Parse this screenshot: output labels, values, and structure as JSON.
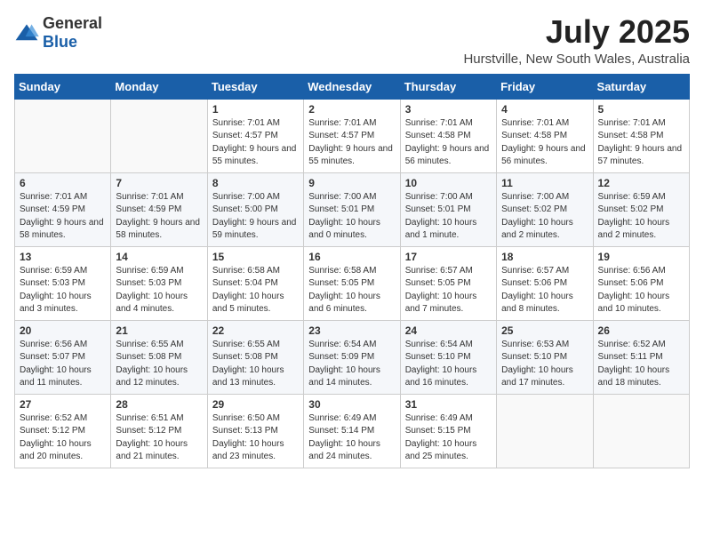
{
  "header": {
    "logo": {
      "general": "General",
      "blue": "Blue"
    },
    "title": "July 2025",
    "location": "Hurstville, New South Wales, Australia"
  },
  "calendar": {
    "days_of_week": [
      "Sunday",
      "Monday",
      "Tuesday",
      "Wednesday",
      "Thursday",
      "Friday",
      "Saturday"
    ],
    "weeks": [
      [
        {
          "day": "",
          "info": ""
        },
        {
          "day": "",
          "info": ""
        },
        {
          "day": "1",
          "info": "Sunrise: 7:01 AM\nSunset: 4:57 PM\nDaylight: 9 hours and 55 minutes."
        },
        {
          "day": "2",
          "info": "Sunrise: 7:01 AM\nSunset: 4:57 PM\nDaylight: 9 hours and 55 minutes."
        },
        {
          "day": "3",
          "info": "Sunrise: 7:01 AM\nSunset: 4:58 PM\nDaylight: 9 hours and 56 minutes."
        },
        {
          "day": "4",
          "info": "Sunrise: 7:01 AM\nSunset: 4:58 PM\nDaylight: 9 hours and 56 minutes."
        },
        {
          "day": "5",
          "info": "Sunrise: 7:01 AM\nSunset: 4:58 PM\nDaylight: 9 hours and 57 minutes."
        }
      ],
      [
        {
          "day": "6",
          "info": "Sunrise: 7:01 AM\nSunset: 4:59 PM\nDaylight: 9 hours and 58 minutes."
        },
        {
          "day": "7",
          "info": "Sunrise: 7:01 AM\nSunset: 4:59 PM\nDaylight: 9 hours and 58 minutes."
        },
        {
          "day": "8",
          "info": "Sunrise: 7:00 AM\nSunset: 5:00 PM\nDaylight: 9 hours and 59 minutes."
        },
        {
          "day": "9",
          "info": "Sunrise: 7:00 AM\nSunset: 5:01 PM\nDaylight: 10 hours and 0 minutes."
        },
        {
          "day": "10",
          "info": "Sunrise: 7:00 AM\nSunset: 5:01 PM\nDaylight: 10 hours and 1 minute."
        },
        {
          "day": "11",
          "info": "Sunrise: 7:00 AM\nSunset: 5:02 PM\nDaylight: 10 hours and 2 minutes."
        },
        {
          "day": "12",
          "info": "Sunrise: 6:59 AM\nSunset: 5:02 PM\nDaylight: 10 hours and 2 minutes."
        }
      ],
      [
        {
          "day": "13",
          "info": "Sunrise: 6:59 AM\nSunset: 5:03 PM\nDaylight: 10 hours and 3 minutes."
        },
        {
          "day": "14",
          "info": "Sunrise: 6:59 AM\nSunset: 5:03 PM\nDaylight: 10 hours and 4 minutes."
        },
        {
          "day": "15",
          "info": "Sunrise: 6:58 AM\nSunset: 5:04 PM\nDaylight: 10 hours and 5 minutes."
        },
        {
          "day": "16",
          "info": "Sunrise: 6:58 AM\nSunset: 5:05 PM\nDaylight: 10 hours and 6 minutes."
        },
        {
          "day": "17",
          "info": "Sunrise: 6:57 AM\nSunset: 5:05 PM\nDaylight: 10 hours and 7 minutes."
        },
        {
          "day": "18",
          "info": "Sunrise: 6:57 AM\nSunset: 5:06 PM\nDaylight: 10 hours and 8 minutes."
        },
        {
          "day": "19",
          "info": "Sunrise: 6:56 AM\nSunset: 5:06 PM\nDaylight: 10 hours and 10 minutes."
        }
      ],
      [
        {
          "day": "20",
          "info": "Sunrise: 6:56 AM\nSunset: 5:07 PM\nDaylight: 10 hours and 11 minutes."
        },
        {
          "day": "21",
          "info": "Sunrise: 6:55 AM\nSunset: 5:08 PM\nDaylight: 10 hours and 12 minutes."
        },
        {
          "day": "22",
          "info": "Sunrise: 6:55 AM\nSunset: 5:08 PM\nDaylight: 10 hours and 13 minutes."
        },
        {
          "day": "23",
          "info": "Sunrise: 6:54 AM\nSunset: 5:09 PM\nDaylight: 10 hours and 14 minutes."
        },
        {
          "day": "24",
          "info": "Sunrise: 6:54 AM\nSunset: 5:10 PM\nDaylight: 10 hours and 16 minutes."
        },
        {
          "day": "25",
          "info": "Sunrise: 6:53 AM\nSunset: 5:10 PM\nDaylight: 10 hours and 17 minutes."
        },
        {
          "day": "26",
          "info": "Sunrise: 6:52 AM\nSunset: 5:11 PM\nDaylight: 10 hours and 18 minutes."
        }
      ],
      [
        {
          "day": "27",
          "info": "Sunrise: 6:52 AM\nSunset: 5:12 PM\nDaylight: 10 hours and 20 minutes."
        },
        {
          "day": "28",
          "info": "Sunrise: 6:51 AM\nSunset: 5:12 PM\nDaylight: 10 hours and 21 minutes."
        },
        {
          "day": "29",
          "info": "Sunrise: 6:50 AM\nSunset: 5:13 PM\nDaylight: 10 hours and 23 minutes."
        },
        {
          "day": "30",
          "info": "Sunrise: 6:49 AM\nSunset: 5:14 PM\nDaylight: 10 hours and 24 minutes."
        },
        {
          "day": "31",
          "info": "Sunrise: 6:49 AM\nSunset: 5:15 PM\nDaylight: 10 hours and 25 minutes."
        },
        {
          "day": "",
          "info": ""
        },
        {
          "day": "",
          "info": ""
        }
      ]
    ]
  }
}
